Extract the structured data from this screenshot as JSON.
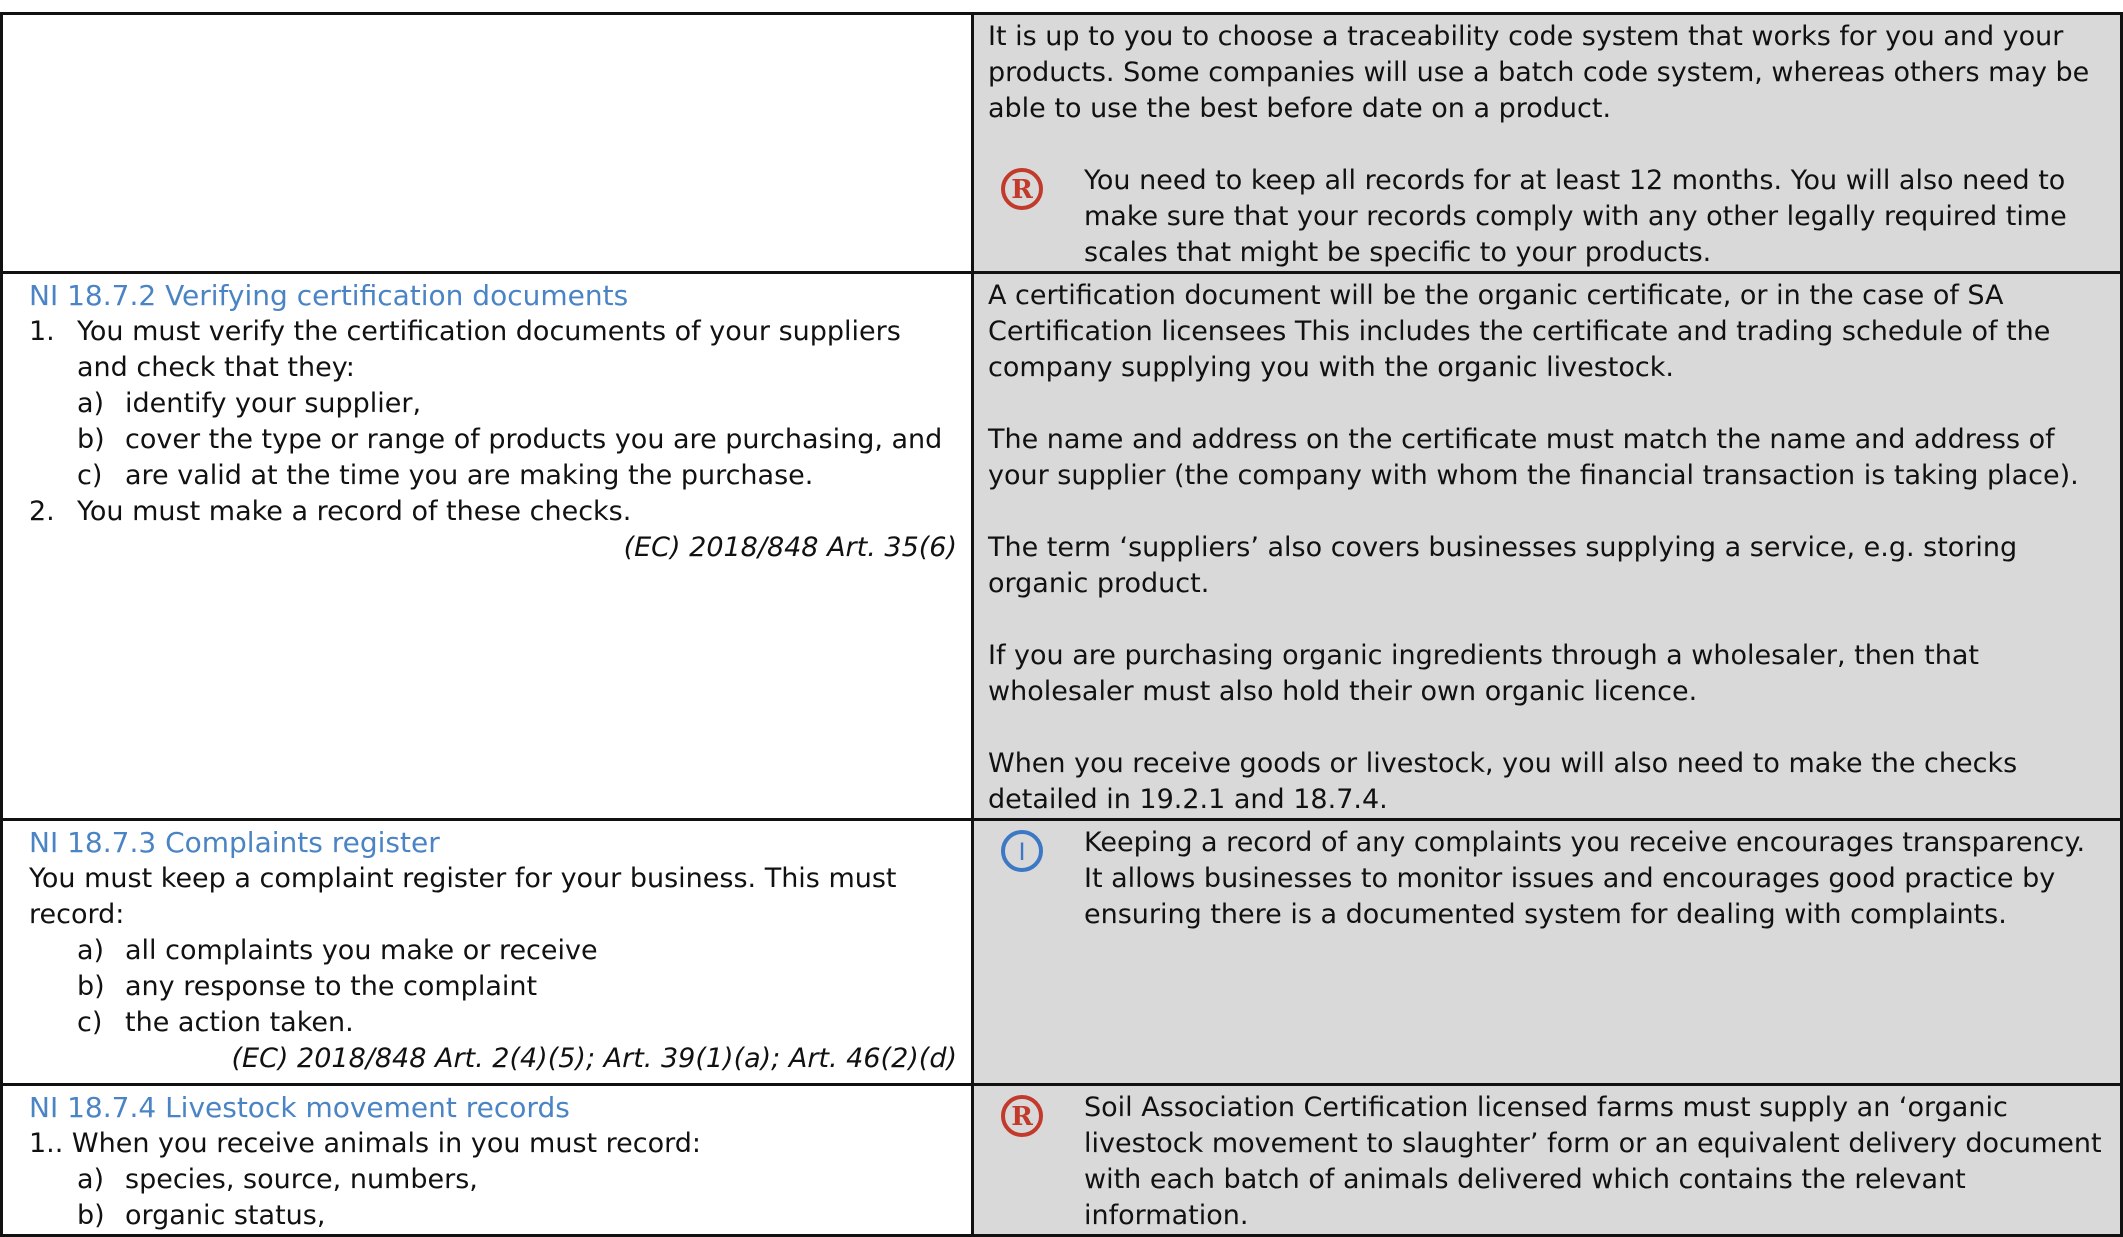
{
  "row1": {
    "right": {
      "paragraphs": [
        "It is up to you to choose a traceability code system that works for you and your products. Some companies will use a batch code system, whereas others may be able to use the best before date on a product."
      ],
      "note": {
        "icon": "R",
        "text": "You need to keep all records for at least 12 months. You will also need to make sure that your records comply with any other legally required time scales that might be specific to your products."
      }
    }
  },
  "row2": {
    "left": {
      "heading": "NI 18.7.2 Verifying certification documents",
      "items": [
        {
          "marker": "1.",
          "text": "You must verify the certification documents of your suppliers and check that they:"
        },
        {
          "marker": "2.",
          "text": "You must make a record of these checks."
        }
      ],
      "subitems": [
        {
          "marker": "a)",
          "text": "identify your supplier,"
        },
        {
          "marker": "b)",
          "text": "cover the type or range of products you are purchasing, and"
        },
        {
          "marker": "c)",
          "text": "are valid at the time you are making the purchase."
        }
      ],
      "citation": "(EC) 2018/848 Art. 35(6)"
    },
    "right": {
      "paragraphs": [
        "A certification document will be the organic certificate, or in the case of SA Certification licensees This includes the certificate and trading schedule of the company supplying you with the organic livestock.",
        "The name and address on the certificate must match the name and address of your supplier (the company with whom the financial transaction is taking place).",
        "The term ‘suppliers’ also covers businesses supplying a service, e.g. storing organic product.",
        "If you are purchasing organic ingredients through a wholesaler, then that wholesaler must also hold their own organic licence.",
        "When you receive goods or livestock, you will also need to make the checks detailed in 19.2.1 and 18.7.4."
      ]
    }
  },
  "row3": {
    "left": {
      "heading": "NI 18.7.3 Complaints register",
      "intro": "You must keep a complaint register for your business. This must record:",
      "subitems": [
        {
          "marker": "a)",
          "text": "all complaints you make or receive"
        },
        {
          "marker": "b)",
          "text": "any response to the complaint"
        },
        {
          "marker": "c)",
          "text": "the action taken."
        }
      ],
      "citation": "(EC) 2018/848 Art. 2(4)(5); Art. 39(1)(a); Art. 46(2)(d)"
    },
    "right": {
      "note": {
        "icon": "I",
        "text": "Keeping a record of any complaints you receive encourages transparency. It allows businesses to monitor issues and encourages good practice by ensuring there is a documented system for dealing with complaints."
      }
    }
  },
  "row4": {
    "left": {
      "heading": "NI 18.7.4 Livestock movement records",
      "intro": "1.. When you receive animals in you must record:",
      "subitems": [
        {
          "marker": "a)",
          "text": "species, source, numbers,"
        },
        {
          "marker": "b)",
          "text": "organic status,"
        }
      ]
    },
    "right": {
      "note": {
        "icon": "R",
        "text": "Soil Association Certification licensed farms must supply an ‘organic livestock movement to slaughter’ form or an equivalent delivery document with each batch of animals delivered which contains the relevant information."
      }
    }
  },
  "colors": {
    "heading": "#4a84c4",
    "shaded_cell": "#d9d9d9",
    "r_icon": "#c23a2b",
    "i_icon": "#3c78c4"
  }
}
